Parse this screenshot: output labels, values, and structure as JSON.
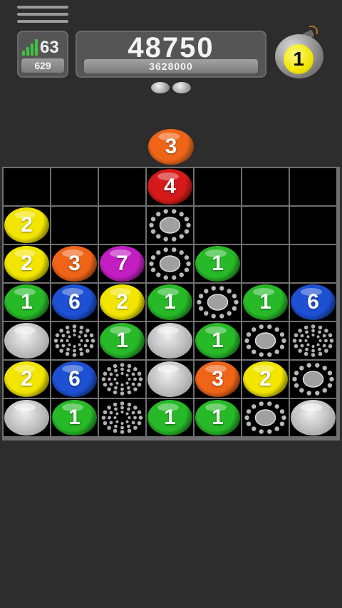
{
  "header": {
    "level": "63",
    "level_sub": "629",
    "score": "48750",
    "target": "3628000",
    "bomb_count": "1"
  },
  "next_ball": {
    "value": "3",
    "color": "orange"
  },
  "colors": {
    "red": "#d61a1a",
    "orange": "#f06418",
    "yellow": "#f2e600",
    "purple": "#c21ec2",
    "green": "#27b927",
    "blue": "#1d50d2",
    "signal_green": "#3fc43f"
  },
  "board": {
    "rows": [
      [
        {
          "t": "empty"
        },
        {
          "t": "empty"
        },
        {
          "t": "empty"
        },
        {
          "t": "ball",
          "v": "4",
          "c": "red"
        },
        {
          "t": "empty"
        },
        {
          "t": "empty"
        },
        {
          "t": "empty"
        }
      ],
      [
        {
          "t": "ball",
          "v": "2",
          "c": "yellow"
        },
        {
          "t": "empty"
        },
        {
          "t": "empty"
        },
        {
          "t": "cracked"
        },
        {
          "t": "empty"
        },
        {
          "t": "empty"
        },
        {
          "t": "empty"
        }
      ],
      [
        {
          "t": "ball",
          "v": "2",
          "c": "yellow"
        },
        {
          "t": "ball",
          "v": "3",
          "c": "orange"
        },
        {
          "t": "ball",
          "v": "7",
          "c": "purple"
        },
        {
          "t": "cracked"
        },
        {
          "t": "ball",
          "v": "1",
          "c": "green"
        },
        {
          "t": "empty"
        },
        {
          "t": "empty"
        }
      ],
      [
        {
          "t": "ball",
          "v": "1",
          "c": "green"
        },
        {
          "t": "ball",
          "v": "6",
          "c": "blue"
        },
        {
          "t": "ball",
          "v": "2",
          "c": "yellow"
        },
        {
          "t": "ball",
          "v": "1",
          "c": "green"
        },
        {
          "t": "cracked"
        },
        {
          "t": "ball",
          "v": "1",
          "c": "green"
        },
        {
          "t": "ball",
          "v": "6",
          "c": "blue"
        }
      ],
      [
        {
          "t": "gray"
        },
        {
          "t": "dots"
        },
        {
          "t": "ball",
          "v": "1",
          "c": "green"
        },
        {
          "t": "gray"
        },
        {
          "t": "ball",
          "v": "1",
          "c": "green"
        },
        {
          "t": "cracked"
        },
        {
          "t": "dots"
        }
      ],
      [
        {
          "t": "ball",
          "v": "2",
          "c": "yellow"
        },
        {
          "t": "ball",
          "v": "6",
          "c": "blue"
        },
        {
          "t": "dots"
        },
        {
          "t": "gray"
        },
        {
          "t": "ball",
          "v": "3",
          "c": "orange"
        },
        {
          "t": "ball",
          "v": "2",
          "c": "yellow"
        },
        {
          "t": "cracked"
        }
      ],
      [
        {
          "t": "gray"
        },
        {
          "t": "ball",
          "v": "1",
          "c": "green"
        },
        {
          "t": "dots"
        },
        {
          "t": "ball",
          "v": "1",
          "c": "green"
        },
        {
          "t": "ball",
          "v": "1",
          "c": "green"
        },
        {
          "t": "cracked"
        },
        {
          "t": "gray"
        }
      ]
    ]
  }
}
